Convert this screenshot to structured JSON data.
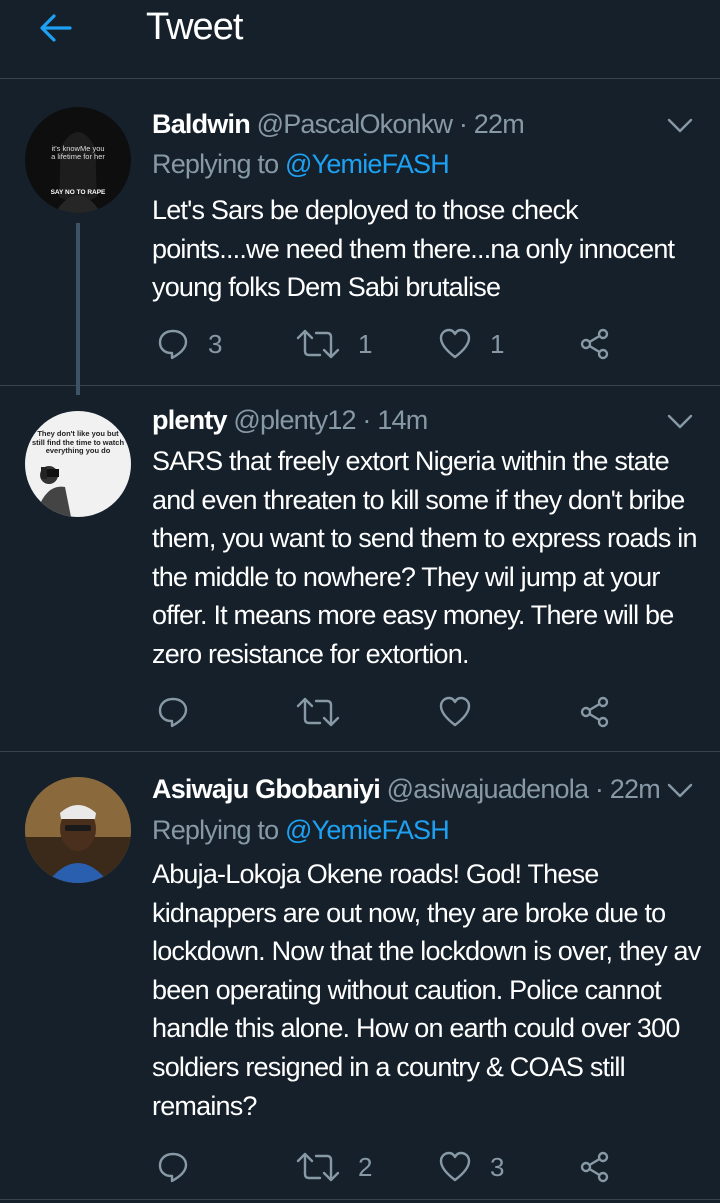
{
  "header": {
    "title": "Tweet"
  },
  "tweets": [
    {
      "display_name": "Baldwin",
      "handle": "@PascalOkonkw",
      "time": "· 22m",
      "replying_prefix": "Replying to",
      "replying_handle": "@YemieFASH",
      "text": "Let's Sars be deployed to those check points....we need them there...na only innocent young folks Dem Sabi brutalise",
      "avatar_text": [
        "it's knowMe you",
        "a lifetime for her",
        "SAY NO TO RAPE"
      ],
      "replies": "3",
      "retweets": "1",
      "likes": "1"
    },
    {
      "display_name": "plenty",
      "handle": "@plenty12",
      "time": "· 14m",
      "text": "SARS that freely extort Nigeria within the state and even threaten to kill some if they don't bribe them, you want to send them to express roads in the middle to nowhere?  They wil jump at your offer. It means more easy money. There will be zero resistance for extortion.",
      "avatar_text": "They don't like you but still find the time to watch everything you do",
      "replies": "",
      "retweets": "",
      "likes": ""
    },
    {
      "display_name": "Asiwaju Gbobaniyi",
      "handle": "@asiwajuadenola",
      "time": "· 22m",
      "replying_prefix": "Replying to",
      "replying_handle": "@YemieFASH",
      "text": "Abuja-Lokoja Okene roads! God! These kidnappers are out now, they are broke due to lockdown. Now that the lockdown is over, they av been operating without caution. Police cannot handle this alone. How on earth could over 300 soldiers resigned in a country & COAS still remains?",
      "replies": "",
      "retweets": "2",
      "likes": "3"
    }
  ],
  "icons": {
    "back": "arrow-left-icon",
    "more": "chevron-down-icon",
    "reply": "reply-icon",
    "retweet": "retweet-icon",
    "like": "heart-icon",
    "share": "share-icon"
  },
  "colors": {
    "background": "#15202b",
    "accent": "#1da1f2",
    "muted": "#8899a6",
    "divider": "#38444d"
  }
}
